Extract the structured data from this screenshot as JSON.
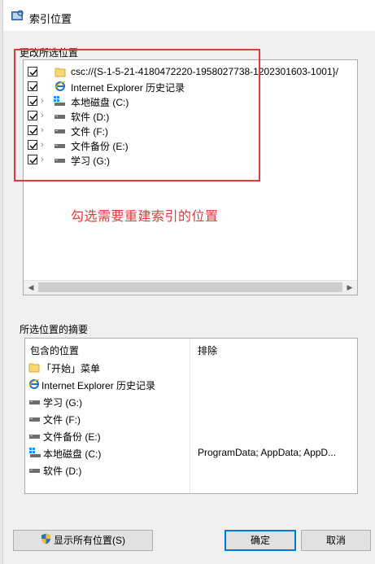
{
  "window": {
    "title": "索引位置"
  },
  "locations_group": {
    "label": "更改所选位置",
    "items": [
      {
        "label": "csc://{S-1-5-21-4180472220-1958027738-1202301603-1001}/",
        "checked": true,
        "expandable": false,
        "icon": "folder-icon"
      },
      {
        "label": "Internet Explorer 历史记录",
        "checked": true,
        "expandable": false,
        "icon": "ie-icon"
      },
      {
        "label": "本地磁盘 (C:)",
        "checked": true,
        "expandable": true,
        "icon": "system-drive-icon"
      },
      {
        "label": "软件 (D:)",
        "checked": true,
        "expandable": true,
        "icon": "drive-icon"
      },
      {
        "label": "文件 (F:)",
        "checked": true,
        "expandable": true,
        "icon": "drive-icon"
      },
      {
        "label": "文件备份 (E:)",
        "checked": true,
        "expandable": true,
        "icon": "drive-icon"
      },
      {
        "label": "学习 (G:)",
        "checked": true,
        "expandable": true,
        "icon": "drive-icon"
      }
    ]
  },
  "annotation": {
    "text": "勾选需要重建索引的位置",
    "color": "#e23a3a"
  },
  "summary_group": {
    "label": "所选位置的摘要",
    "col_included": "包含的位置",
    "col_excluded": "排除",
    "rows": [
      {
        "label": "「开始」菜单",
        "icon": "folder-icon",
        "excluded": ""
      },
      {
        "label": "Internet Explorer 历史记录",
        "icon": "ie-icon",
        "excluded": ""
      },
      {
        "label": "学习 (G:)",
        "icon": "drive-icon",
        "excluded": ""
      },
      {
        "label": "文件 (F:)",
        "icon": "drive-icon",
        "excluded": ""
      },
      {
        "label": "文件备份 (E:)",
        "icon": "drive-icon",
        "excluded": ""
      },
      {
        "label": "本地磁盘 (C:)",
        "icon": "system-drive-icon",
        "excluded": "ProgramData; AppData; AppD..."
      },
      {
        "label": "软件 (D:)",
        "icon": "drive-icon",
        "excluded": ""
      }
    ]
  },
  "buttons": {
    "show_all": "显示所有位置(S)",
    "ok": "确定",
    "cancel": "取消"
  }
}
